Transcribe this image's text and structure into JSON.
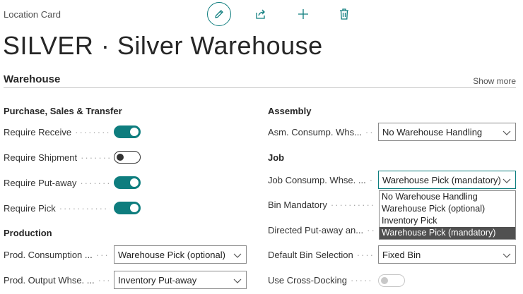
{
  "header": {
    "page_caption": "Location Card",
    "title": "SILVER · Silver Warehouse",
    "actions": [
      "edit-icon",
      "share-icon",
      "new-icon",
      "delete-icon"
    ]
  },
  "section": {
    "title": "Warehouse",
    "show_more": "Show more"
  },
  "left": {
    "purchase_group": "Purchase, Sales & Transfer",
    "require_receive": {
      "label": "Require Receive",
      "value": true
    },
    "require_shipment": {
      "label": "Require Shipment",
      "value": false
    },
    "require_putaway": {
      "label": "Require Put-away",
      "value": true
    },
    "require_pick": {
      "label": "Require Pick",
      "value": true
    },
    "production_group": "Production",
    "prod_consumption": {
      "label": "Prod. Consumption ...",
      "value": "Warehouse Pick (optional)"
    },
    "prod_output": {
      "label": "Prod. Output Whse. ...",
      "value": "Inventory Put-away"
    }
  },
  "right": {
    "assembly_group": "Assembly",
    "asm_consump": {
      "label": "Asm. Consump. Whs...",
      "value": "No Warehouse Handling"
    },
    "job_group": "Job",
    "job_consump": {
      "label": "Job Consump. Whse. ...",
      "value": "Warehouse Pick (mandatory)"
    },
    "bin_mandatory": {
      "label": "Bin Mandatory"
    },
    "directed_putaway": {
      "label": "Directed Put-away an..."
    },
    "default_bin": {
      "label": "Default Bin Selection",
      "value": "Fixed Bin"
    },
    "cross_docking": {
      "label": "Use Cross-Docking",
      "value": false
    }
  },
  "dropdown": {
    "options": [
      "No Warehouse Handling",
      "Warehouse Pick (optional)",
      "Inventory Pick",
      "Warehouse Pick (mandatory)"
    ],
    "selected": "Warehouse Pick (mandatory)"
  },
  "colors": {
    "accent": "#0e7d7e",
    "selected_option_bg": "#505050"
  }
}
